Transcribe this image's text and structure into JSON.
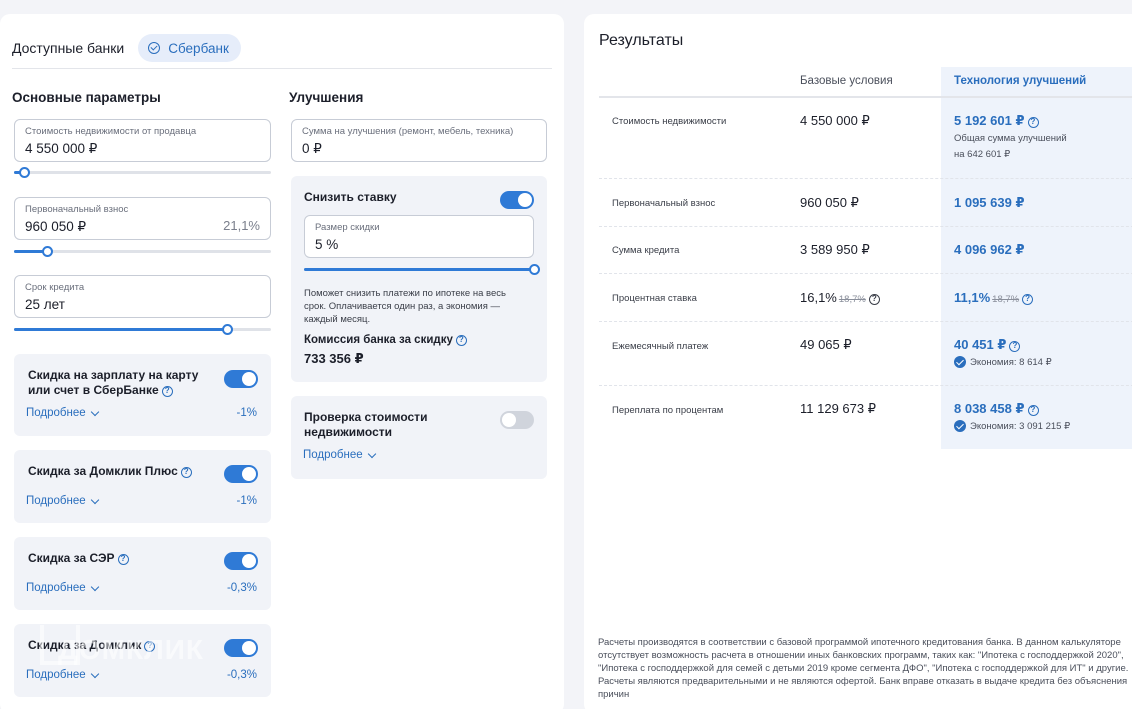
{
  "banks": {
    "label": "Доступные банки",
    "selected_bank": "Сбербанк"
  },
  "basic": {
    "title": "Основные параметры",
    "property_cost": {
      "label": "Стоимость недвижимости от продавца",
      "value": "4 550 000 ₽",
      "slider_fraction": 0.04
    },
    "down_payment": {
      "label": "Первоначальный взнос",
      "value": "960 050 ₽",
      "percent": "21,1%",
      "slider_fraction": 0.13
    },
    "loan_term": {
      "label": "Срок кредита",
      "value": "25 лет",
      "slider_fraction": 0.83
    }
  },
  "discounts": [
    {
      "title": "Скидка на зарплату на карту или счет в СберБанке",
      "more": "Подробнее",
      "value": "-1%",
      "enabled": true
    },
    {
      "title": "Скидка за Домклик Плюс",
      "more": "Подробнее",
      "value": "-1%",
      "enabled": true
    },
    {
      "title": "Скидка за СЭР",
      "more": "Подробнее",
      "value": "-0,3%",
      "enabled": true
    },
    {
      "title": "Скидка за Домклик",
      "more": "Подробнее",
      "value": "-0,3%",
      "enabled": true
    }
  ],
  "improvements": {
    "title": "Улучшения",
    "amount": {
      "label": "Сумма на улучшения (ремонт, мебель, техника)",
      "value": "0 ₽"
    },
    "reduce_rate": {
      "title": "Снизить ставку",
      "enabled": true,
      "discount_label": "Размер скидки",
      "discount_value": "5 %",
      "slider_fraction": 1.0,
      "note": "Поможет снизить платежи по ипотеке на весь срок. Оплачивается один раз, а экономия — каждый месяц.",
      "commission_label": "Комиссия банка за скидку",
      "commission_value": "733 356 ₽"
    },
    "valuation": {
      "title": "Проверка стоимости недвижимости",
      "more": "Подробнее",
      "enabled": false
    }
  },
  "results": {
    "title": "Результаты",
    "col_base": "Базовые условия",
    "col_tech": "Технология улучшений",
    "rows": [
      {
        "label": "Стоимость недвижимости",
        "base": "4 550 000 ₽",
        "tech": "5 192 601 ₽",
        "note_line1": "Общая сумма улучшений",
        "note_line2": "на 642 601 ₽"
      },
      {
        "label": "Первоначальный взнос",
        "base": "960 050 ₽",
        "tech": "1 095 639 ₽"
      },
      {
        "label": "Сумма кредита",
        "base": "3 589 950 ₽",
        "tech": "4 096 962 ₽"
      },
      {
        "label": "Процентная ставка",
        "base": "16,1%",
        "base_old": "18,7%",
        "tech": "11,1%",
        "tech_old": "18,7%"
      },
      {
        "label": "Ежемесячный платеж",
        "base": "49 065 ₽",
        "tech": "40 451 ₽",
        "saving": "Экономия: 8 614 ₽"
      },
      {
        "label": "Переплата по процентам",
        "base": "11 129 673 ₽",
        "tech": "8 038 458 ₽",
        "saving": "Экономия: 3 091 215 ₽"
      }
    ],
    "disclaimer": "Расчеты производятся в соответствии с базовой программой ипотечного кредитования банка. В данном калькуляторе отсутствует возможность расчета в отношении иных банковских программ, таких как: \"Ипотека с господдержкой 2020\", \"Ипотека с господдержкой для семей с детьми 2019 кроме сегмента ДФО\", \"Ипотека с господдержкой для ИТ\" и другие. Расчеты являются предварительными и не являются офертой. Банк вправе отказать в выдаче кредита без объяснения причин"
  },
  "watermark": "ДОМКЛИК",
  "colors": {
    "accent": "#2f7ad6",
    "link": "#2a6ebd",
    "card_bg": "#f1f3f8",
    "tech_col_bg": "#eef3fb"
  }
}
